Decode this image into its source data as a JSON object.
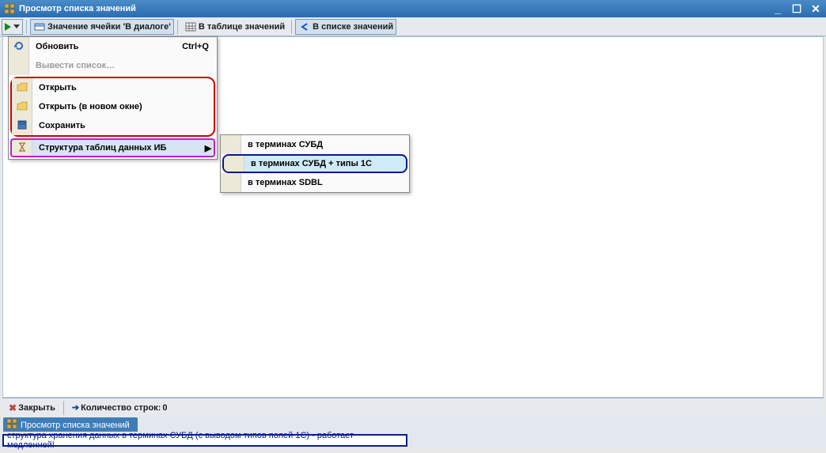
{
  "window": {
    "title": "Просмотр списка значений"
  },
  "toolbar": {
    "cell_value": "Значение ячейки 'В диалоге'",
    "in_table": "В таблице значений",
    "in_list": "В списке значений"
  },
  "menu": {
    "refresh": {
      "label": "Обновить",
      "shortcut": "Ctrl+Q"
    },
    "export": {
      "label": "Вывести список…"
    },
    "open": {
      "label": "Открыть"
    },
    "open_new": {
      "label": "Открыть (в новом окне)"
    },
    "save": {
      "label": "Сохранить"
    },
    "struct": {
      "label": "Структура таблиц данных ИБ"
    }
  },
  "submenu": {
    "dbms": "в терминах СУБД",
    "dbms_1c": "в терминах СУБД + типы 1С",
    "sdbl": "в терминах SDBL"
  },
  "bottom": {
    "close": "Закрыть",
    "rowcount_label": "Количество строк:",
    "rowcount_value": "0"
  },
  "taskbar": {
    "tab": "Просмотр списка значений"
  },
  "status": {
    "text": "структура хранения данных в терминах СУБД (с выводом типов полей 1С) - работает медленней!"
  }
}
